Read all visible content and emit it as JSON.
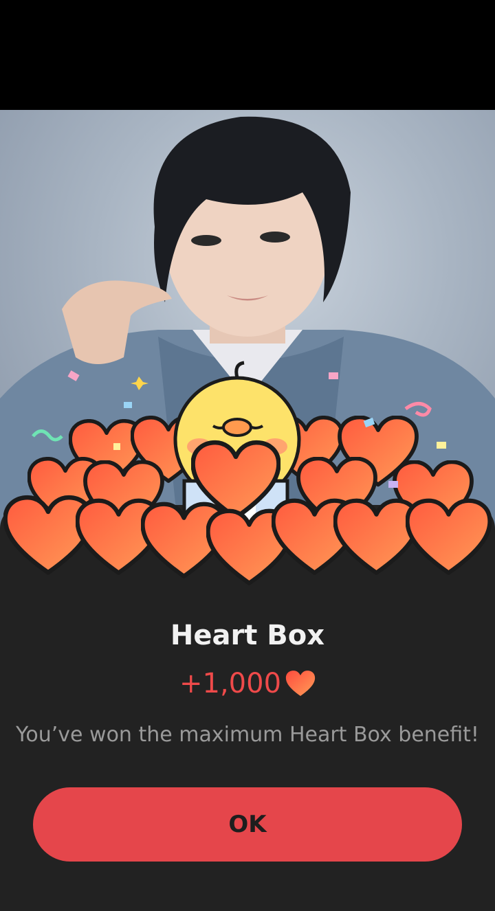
{
  "dialog": {
    "title": "Heart Box",
    "reward_amount": "+1,000",
    "reward_icon": "heart-icon",
    "message": "You’ve won the maximum Heart Box benefit!",
    "ok_label": "OK"
  },
  "colors": {
    "accent": "#e5464b",
    "reward_text": "#ef4a4a",
    "sheet_background": "#222222"
  }
}
